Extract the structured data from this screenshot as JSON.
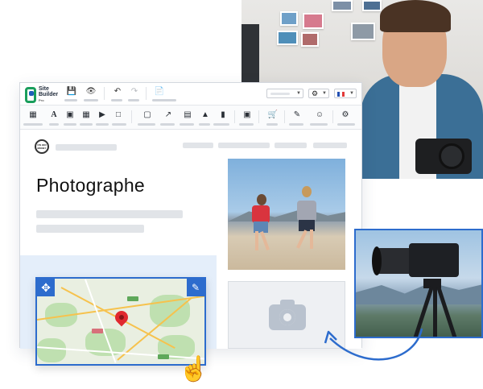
{
  "app": {
    "brand_line1": "Site",
    "brand_line2": "Builder",
    "brand_sub": "Pro"
  },
  "site": {
    "logo_text": "ON JEN MONEY",
    "heading": "Photographe"
  },
  "icons": {
    "toolbar_top": [
      "save-icon",
      "preview-eye-icon",
      "undo-icon",
      "redo-icon",
      "page-icon"
    ],
    "toolbar_main": [
      "layout-icon",
      "text-icon",
      "image-icon",
      "gallery-icon",
      "video-icon",
      "map-icon",
      "box-icon",
      "share-icon",
      "form-icon",
      "sitemap-icon",
      "bookmark-icon",
      "embed-icon",
      "cart-icon",
      "edit-icon",
      "users-icon",
      "settings-icon"
    ],
    "map_controls": [
      "move-icon",
      "pencil-icon"
    ]
  },
  "colors": {
    "accent": "#2d6ccd",
    "brand_green": "#1a9e5c",
    "brand_blue": "#1f5fb8",
    "pin_red": "#e0292f",
    "highlight_band": "#e4eefa"
  }
}
